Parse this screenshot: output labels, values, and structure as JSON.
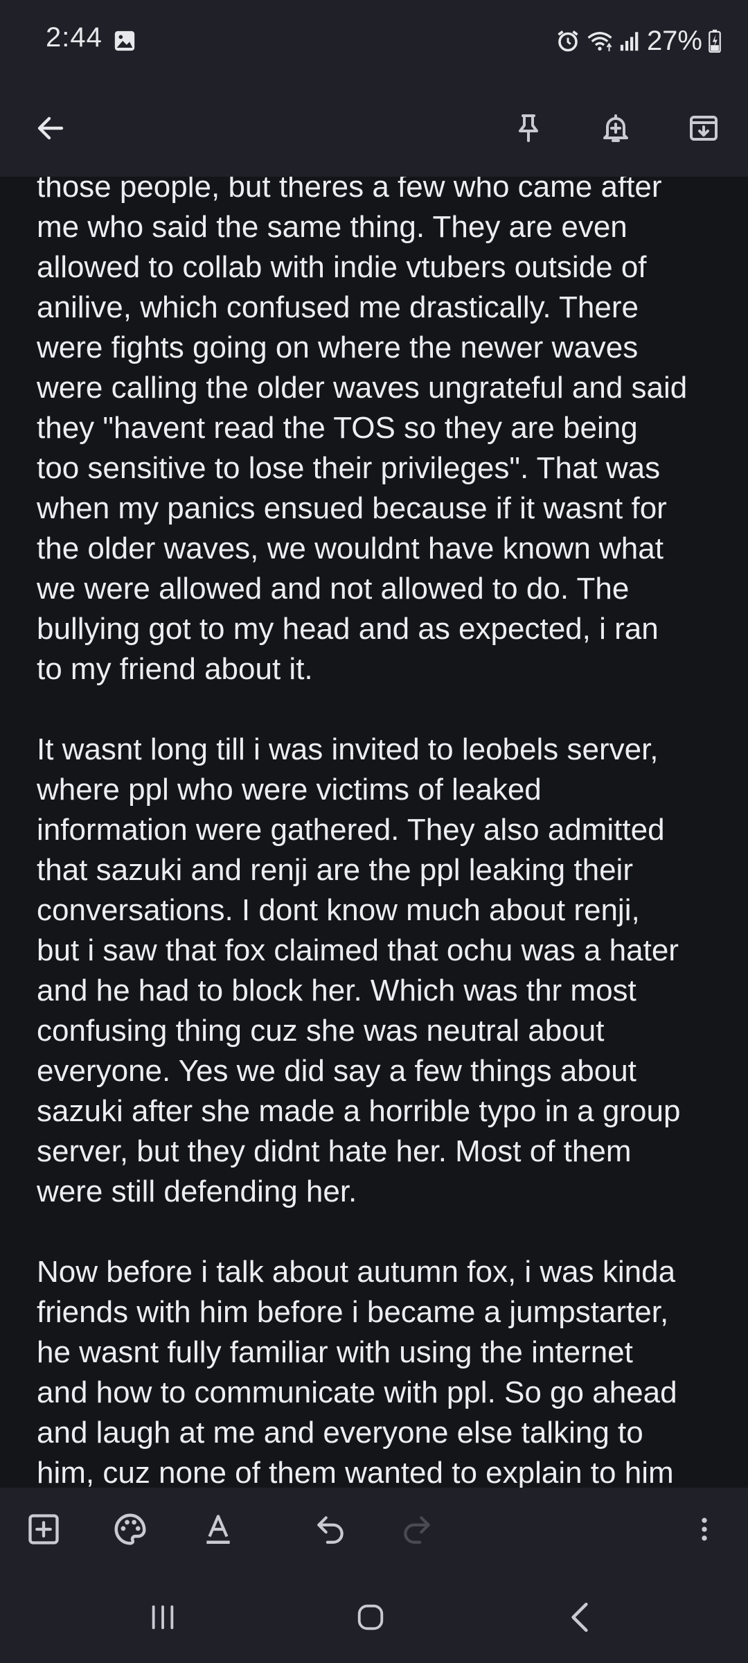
{
  "status_bar": {
    "time": "2:44",
    "battery": "27%",
    "icons": [
      "image-icon",
      "alarm-icon",
      "wifi-icon",
      "signal-icon",
      "battery-charging-icon"
    ]
  },
  "top_bar": {
    "icons": [
      "back-arrow-icon",
      "pin-icon",
      "reminder-bell-icon",
      "archive-icon"
    ]
  },
  "note": {
    "paragraphs": [
      {
        "lines": [
          "those people, but theres a few who came after",
          "me who said the same thing. They are even",
          "allowed to collab with indie vtubers outside of",
          "anilive, which confused me drastically. There",
          "were fights going on where the newer waves",
          "were calling the older waves ungrateful and said",
          "they \"havent read the TOS so they are being",
          "too sensitive to lose their privileges\". That was",
          "when my panics ensued because if it wasnt for",
          "the older waves, we wouldnt have known what",
          "we were allowed and not allowed to do. The",
          "bullying got to my head and as expected, i ran",
          "to my friend about it."
        ]
      },
      {
        "lines": [
          "It wasnt long till i was invited to leobels server,",
          "where ppl who were victims of leaked",
          "information were gathered. They also admitted",
          "that sazuki and renji are the ppl leaking their",
          "conversations. I dont know much about renji,",
          "but i saw that fox claimed that ochu was a hater",
          "and he had to block her. Which was thr most",
          "confusing thing cuz she was neutral about",
          "everyone. Yes we did say a few things about",
          "sazuki after she made a horrible typo in a group",
          "server, but they didnt hate her. Most of them",
          "were still defending her."
        ]
      },
      {
        "lines": [
          "Now before i talk about autumn fox, i was kinda",
          "friends with him before i became a jumpstarter,",
          "he wasnt fully familiar with using the internet",
          "and how to communicate with ppl. So go ahead",
          "and laugh at me and everyone else talking to",
          "him, cuz none of them wanted to explain to him"
        ]
      }
    ]
  },
  "editor_toolbar": {
    "icons": [
      "add-box-icon",
      "palette-icon",
      "text-format-icon",
      "undo-icon",
      "redo-icon",
      "more-vert-icon"
    ]
  },
  "nav_bar": {
    "icons": [
      "recents-icon",
      "home-icon",
      "back-icon"
    ]
  },
  "colors": {
    "background": "#141519",
    "bars": "#202128",
    "text": "#eeeef2",
    "icon": "#c9cad2",
    "icon_disabled": "#4a4b52"
  }
}
